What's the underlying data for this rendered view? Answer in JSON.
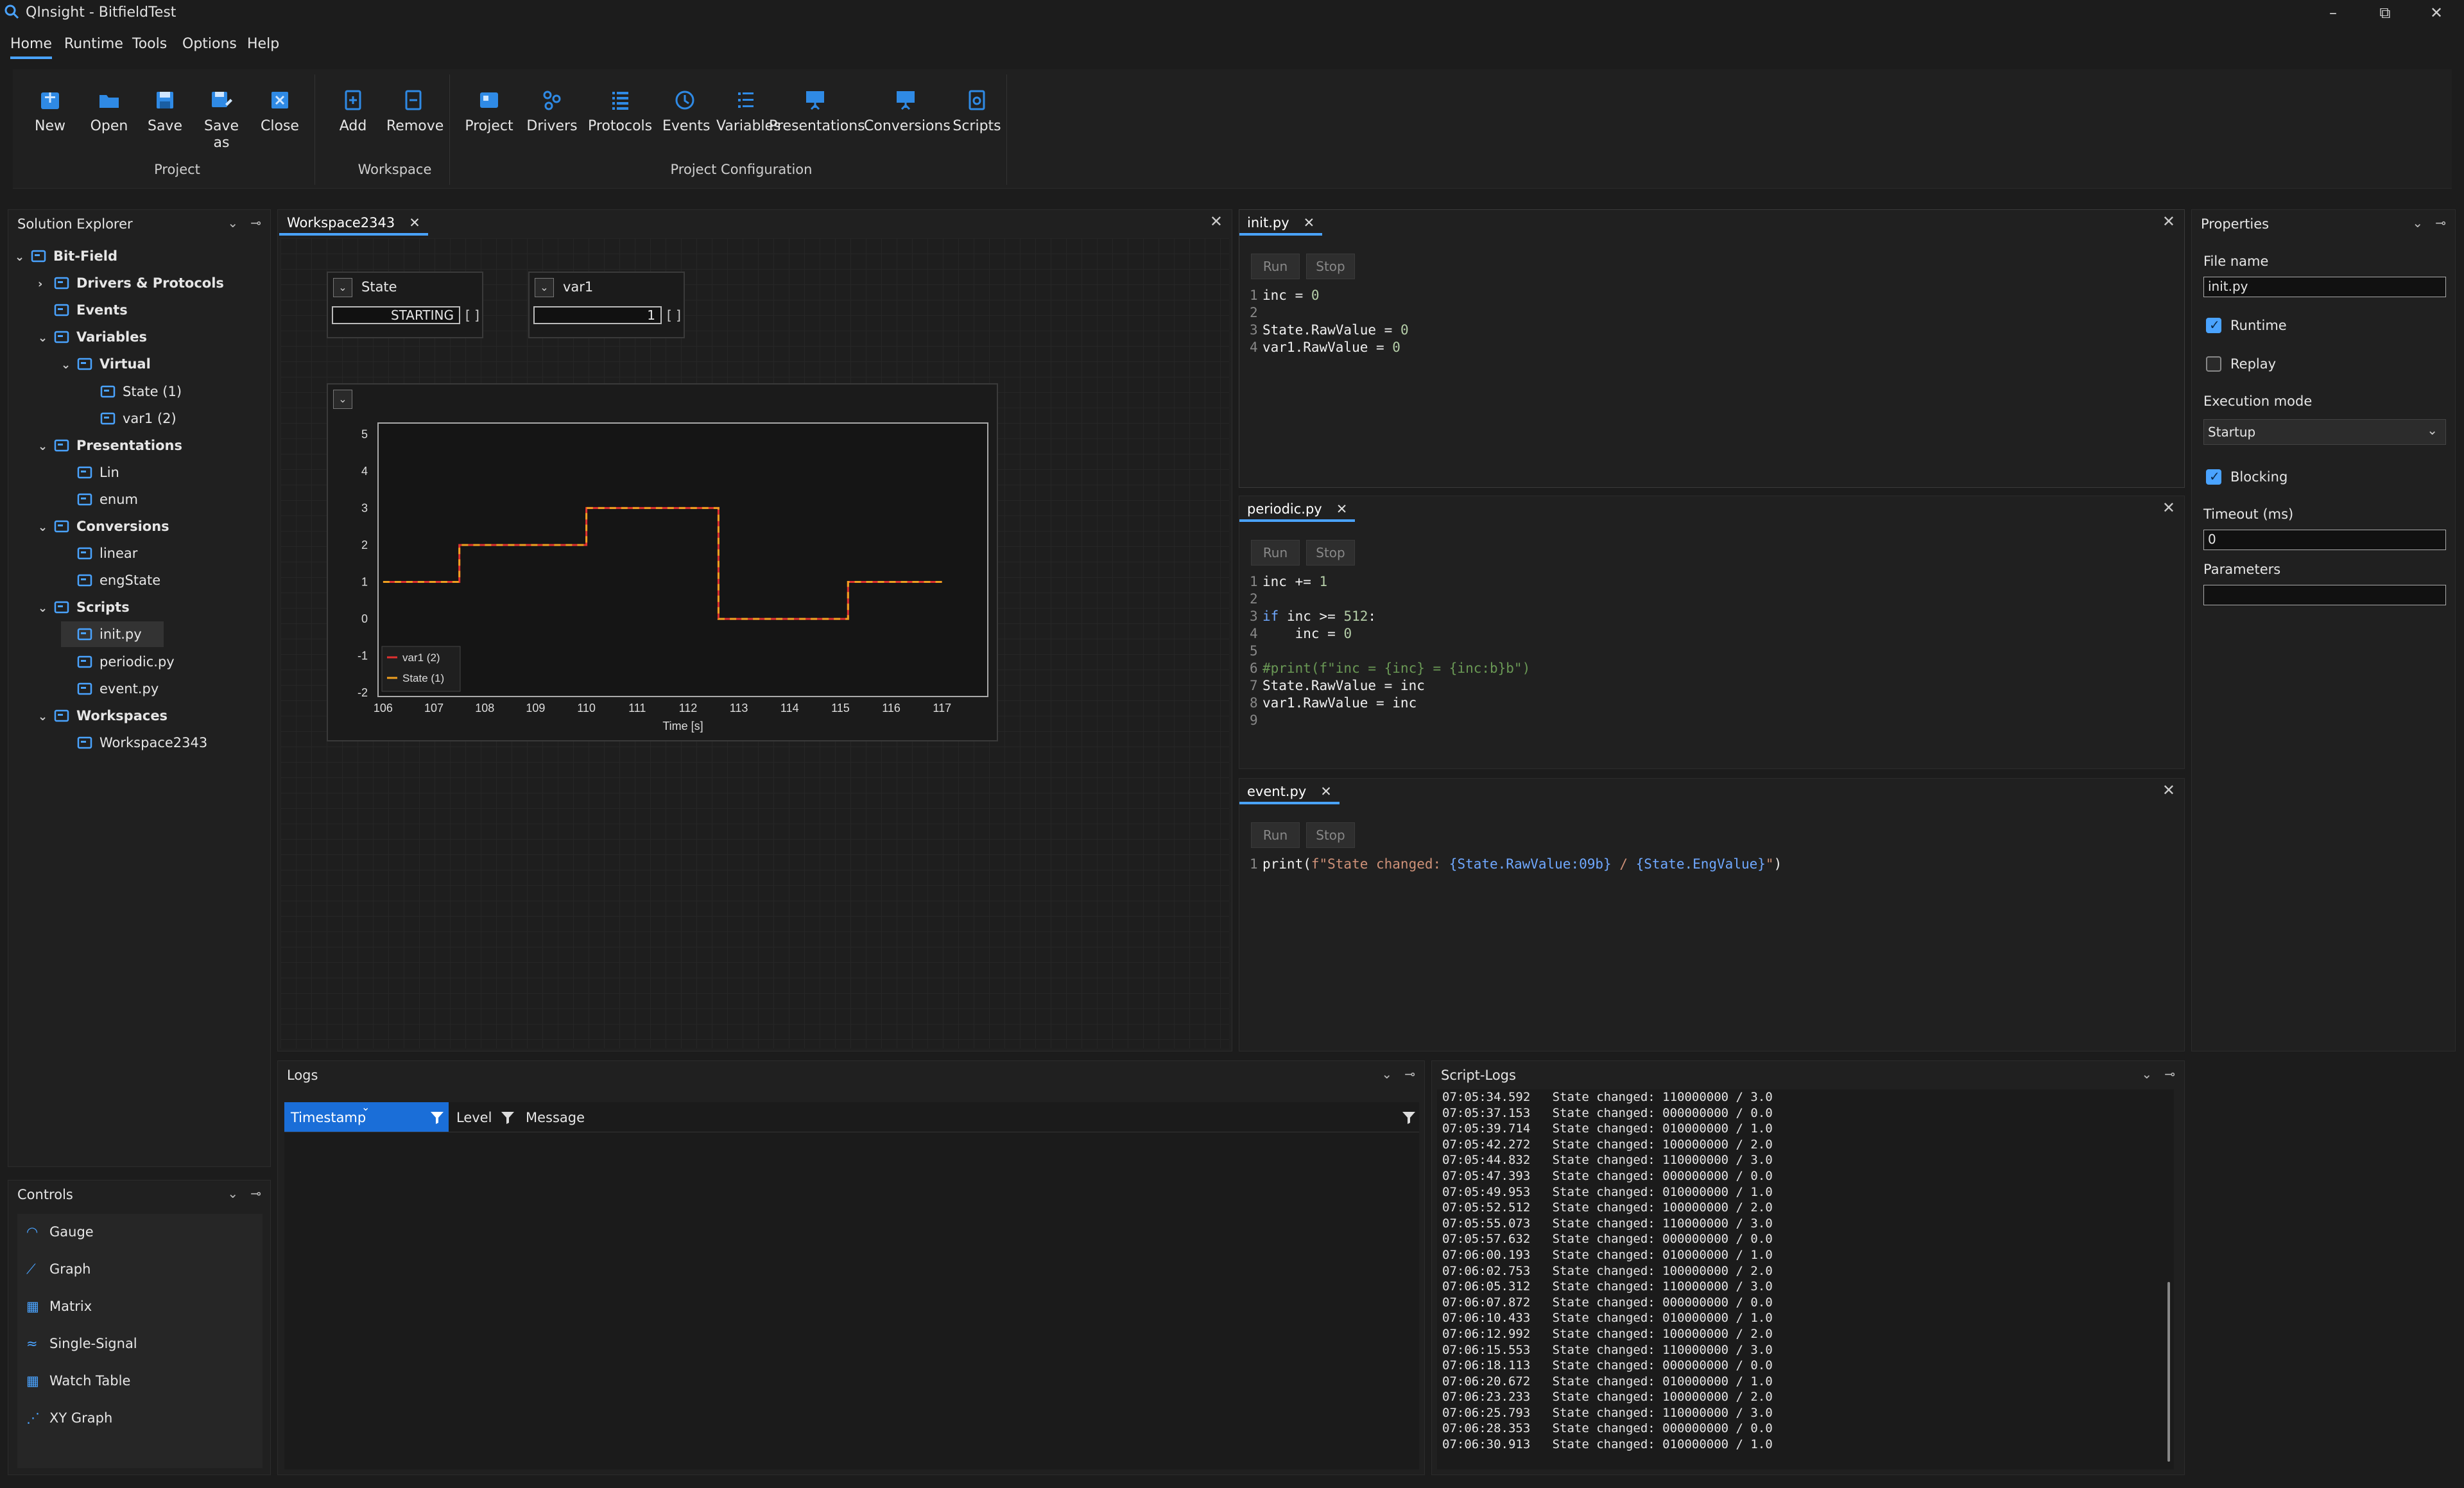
{
  "window": {
    "title": "QInsight - BitfieldTest"
  },
  "menu": [
    "Home",
    "Runtime",
    "Tools",
    "Options",
    "Help"
  ],
  "ribbon": {
    "project_buttons": [
      "New",
      "Open",
      "Save",
      "Save\nas",
      "Close"
    ],
    "project_group": "Project",
    "workspace_buttons": [
      "Add",
      "Remove"
    ],
    "workspace_group": "Workspace",
    "config_buttons": [
      "Project",
      "Drivers",
      "Protocols",
      "Events",
      "Variables",
      "Presentations",
      "Conversions",
      "Scripts"
    ],
    "config_group": "Project Configuration"
  },
  "solution_explorer": {
    "title": "Solution Explorer",
    "items": [
      {
        "label": "Bit-Field",
        "level": 0,
        "chev": "v",
        "bold": true,
        "icon": "project-icon"
      },
      {
        "label": "Drivers & Protocols",
        "level": 1,
        "chev": ">",
        "bold": true,
        "icon": "drivers-icon"
      },
      {
        "label": "Events",
        "level": 1,
        "chev": "",
        "bold": true,
        "icon": "events-icon"
      },
      {
        "label": "Variables",
        "level": 1,
        "chev": "v",
        "bold": true,
        "icon": "variables-icon"
      },
      {
        "label": "Virtual",
        "level": 2,
        "chev": "v",
        "bold": true,
        "icon": "folder-icon"
      },
      {
        "label": "State (1)",
        "level": 3,
        "chev": "",
        "bold": false,
        "icon": "signal-icon"
      },
      {
        "label": "var1 (2)",
        "level": 3,
        "chev": "",
        "bold": false,
        "icon": "signal-icon"
      },
      {
        "label": "Presentations",
        "level": 1,
        "chev": "v",
        "bold": true,
        "icon": "presentations-icon"
      },
      {
        "label": "Lin",
        "level": 2,
        "chev": "",
        "bold": false,
        "icon": "presentation-icon"
      },
      {
        "label": "enum",
        "level": 2,
        "chev": "",
        "bold": false,
        "icon": "presentation-icon"
      },
      {
        "label": "Conversions",
        "level": 1,
        "chev": "v",
        "bold": true,
        "icon": "conversions-icon"
      },
      {
        "label": "linear",
        "level": 2,
        "chev": "",
        "bold": false,
        "icon": "conversion-icon"
      },
      {
        "label": "engState",
        "level": 2,
        "chev": "",
        "bold": false,
        "icon": "conversion-icon"
      },
      {
        "label": "Scripts",
        "level": 1,
        "chev": "v",
        "bold": true,
        "icon": "scripts-icon"
      },
      {
        "label": "init.py",
        "level": 2,
        "chev": "",
        "bold": false,
        "icon": "script-icon",
        "selected": true
      },
      {
        "label": "periodic.py",
        "level": 2,
        "chev": "",
        "bold": false,
        "icon": "script-icon"
      },
      {
        "label": "event.py",
        "level": 2,
        "chev": "",
        "bold": false,
        "icon": "script-icon"
      },
      {
        "label": "Workspaces",
        "level": 1,
        "chev": "v",
        "bold": true,
        "icon": "workspaces-icon"
      },
      {
        "label": "Workspace2343",
        "level": 2,
        "chev": "",
        "bold": false,
        "icon": "workspace-icon"
      }
    ]
  },
  "controls": {
    "title": "Controls",
    "items": [
      "Gauge",
      "Graph",
      "Matrix",
      "Single-Signal",
      "Watch Table",
      "XY Graph"
    ]
  },
  "workspace": {
    "tab": "Workspace2343",
    "state_widget": {
      "label": "State",
      "value": "STARTING",
      "brackets": "[ ]"
    },
    "var1_widget": {
      "label": "var1",
      "value": "1",
      "brackets": "[ ]"
    }
  },
  "chart_data": {
    "type": "line",
    "xlabel": "Time [s]",
    "xlim": [
      105.9,
      117.9
    ],
    "ylim": [
      -2.1,
      5.3
    ],
    "xticks": [
      106,
      107,
      108,
      109,
      110,
      111,
      112,
      113,
      114,
      115,
      116,
      117
    ],
    "yticks": [
      5,
      4,
      3,
      2,
      1,
      0,
      -1,
      -2
    ],
    "legend": "bottom-left",
    "series": [
      {
        "name": "var1 (2)",
        "color": "#e03030",
        "x": [
          106,
          107.5,
          107.5,
          110,
          110,
          112.6,
          112.6,
          115.15,
          115.15,
          117
        ],
        "y": [
          1,
          1,
          2,
          2,
          3,
          3,
          0,
          0,
          1,
          1
        ]
      },
      {
        "name": "State (1)",
        "color": "#f0a020",
        "x": [
          106,
          107.5,
          107.5,
          110,
          110,
          112.6,
          112.6,
          115.15,
          115.15,
          117
        ],
        "y": [
          1,
          1,
          2,
          2,
          3,
          3,
          0,
          0,
          1,
          1
        ]
      }
    ]
  },
  "scripts": {
    "run_label": "Run",
    "stop_label": "Stop",
    "init": {
      "tab": "init.py"
    },
    "periodic": {
      "tab": "periodic.py"
    },
    "event": {
      "tab": "event.py"
    }
  },
  "properties": {
    "title": "Properties",
    "file_name_label": "File name",
    "file_name": "init.py",
    "runtime_label": "Runtime",
    "runtime_checked": true,
    "replay_label": "Replay",
    "replay_checked": false,
    "execution_mode_label": "Execution mode",
    "execution_mode": "Startup",
    "blocking_label": "Blocking",
    "blocking_checked": true,
    "timeout_label": "Timeout (ms)",
    "timeout": "0",
    "parameters_label": "Parameters",
    "parameters": ""
  },
  "logs": {
    "title": "Logs",
    "columns": [
      "Timestamp",
      "Level",
      "Message"
    ]
  },
  "script_logs": {
    "title": "Script-Logs",
    "lines": [
      "07:05:34.592   State changed: 110000000 / 3.0",
      "07:05:37.153   State changed: 000000000 / 0.0",
      "07:05:39.714   State changed: 010000000 / 1.0",
      "07:05:42.272   State changed: 100000000 / 2.0",
      "07:05:44.832   State changed: 110000000 / 3.0",
      "07:05:47.393   State changed: 000000000 / 0.0",
      "07:05:49.953   State changed: 010000000 / 1.0",
      "07:05:52.512   State changed: 100000000 / 2.0",
      "07:05:55.073   State changed: 110000000 / 3.0",
      "07:05:57.632   State changed: 000000000 / 0.0",
      "07:06:00.193   State changed: 010000000 / 1.0",
      "07:06:02.753   State changed: 100000000 / 2.0",
      "07:06:05.312   State changed: 110000000 / 3.0",
      "07:06:07.872   State changed: 000000000 / 0.0",
      "07:06:10.433   State changed: 010000000 / 1.0",
      "07:06:12.992   State changed: 100000000 / 2.0",
      "07:06:15.553   State changed: 110000000 / 3.0",
      "07:06:18.113   State changed: 000000000 / 0.0",
      "07:06:20.672   State changed: 010000000 / 1.0",
      "07:06:23.233   State changed: 100000000 / 2.0",
      "07:06:25.793   State changed: 110000000 / 3.0",
      "07:06:28.353   State changed: 000000000 / 0.0",
      "07:06:30.913   State changed: 010000000 / 1.0"
    ]
  }
}
